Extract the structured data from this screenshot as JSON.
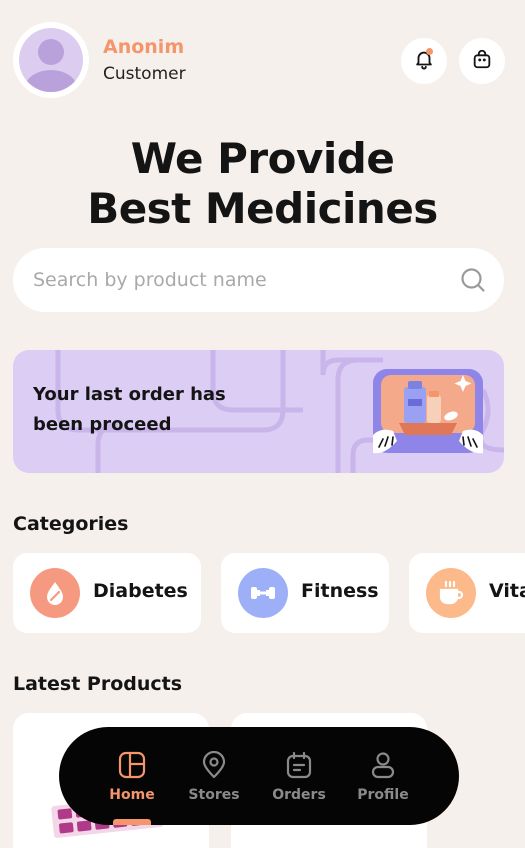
{
  "user": {
    "name": "Anonim",
    "role": "Customer"
  },
  "header": {
    "notification_icon": "bell-icon",
    "cart_icon": "shopping-bag-icon"
  },
  "hero": {
    "line1": "We Provide",
    "line2": "Best Medicines"
  },
  "search": {
    "placeholder": "Search by product name",
    "value": "",
    "icon": "search-icon"
  },
  "banner": {
    "text": "Your last order has been proceed"
  },
  "categories": {
    "title": "Categories",
    "items": [
      {
        "label": "Diabetes",
        "icon": "blood-drop-icon",
        "color": "#f59a80"
      },
      {
        "label": "Fitness",
        "icon": "dumbbell-icon",
        "color": "#9caff7"
      },
      {
        "label": "Vitamins",
        "icon": "cup-icon",
        "color": "#fcb98a"
      }
    ]
  },
  "products": {
    "title": "Latest Products"
  },
  "nav": {
    "items": [
      {
        "label": "Home",
        "icon": "grid-home-icon",
        "active": true
      },
      {
        "label": "Stores",
        "icon": "location-pin-icon",
        "active": false
      },
      {
        "label": "Orders",
        "icon": "clipboard-icon",
        "active": false
      },
      {
        "label": "Profile",
        "icon": "user-icon",
        "active": false
      }
    ]
  },
  "colors": {
    "accent": "#f4956b",
    "background": "#f6f0ed",
    "banner": "#dccdf5",
    "nav": "#050505"
  }
}
